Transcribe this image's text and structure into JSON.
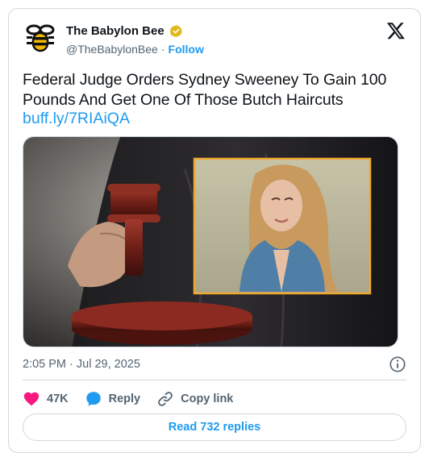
{
  "author": {
    "display_name": "The Babylon Bee",
    "handle": "@TheBabylonBee",
    "separator": "·",
    "follow_label": "Follow",
    "verified_color": "#e2b719"
  },
  "tweet": {
    "text": "Federal Judge Orders Sydney Sweeney To Gain 100 Pounds And Get One Of Those Butch Haircuts",
    "link": "buff.ly/7RIAiQA"
  },
  "meta": {
    "time": "2:05 PM",
    "separator": "·",
    "date": "Jul 29, 2025"
  },
  "actions": {
    "likes": "47K",
    "reply_label": "Reply",
    "copy_label": "Copy link"
  },
  "read_replies_label": "Read 732 replies",
  "colors": {
    "accent": "#1d9bf0",
    "like": "#f91880",
    "border": "#cfd9de",
    "muted": "#536471",
    "inset_border": "#f0a830"
  },
  "icons": [
    "bee-logo-icon",
    "verified-badge-icon",
    "x-logo-icon",
    "info-icon",
    "heart-icon",
    "reply-bubble-icon",
    "link-icon"
  ]
}
